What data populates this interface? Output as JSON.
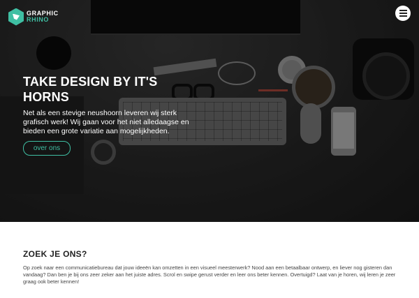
{
  "brand": {
    "name_line1": "GRAPHIC",
    "name_line2": "RHINO",
    "accent_color": "#3fbfa3"
  },
  "header": {
    "menu_icon": "hamburger-menu-icon"
  },
  "hero": {
    "title": "TAKE DESIGN BY IT'S HORNS",
    "text": "Net als een stevige neushoorn leveren wij sterk grafisch werk! Wij gaan voor het niet alledaagse en bieden een grote variatie aan mogelijkheden.",
    "button_label": "over ons"
  },
  "section": {
    "title": "ZOEK JE ONS?",
    "text": "Op zoek naar een communicatiebureau dat jouw ideeën kan omzetten in een visueel meesterwerk? Nood aan een betaalbaar ontwerp, en liever nog gisteren dan vandaag? Dan ben je bij ons zeer zeker aan het juiste adres. Scrol en swipe gerust verder en leer ons beter kennen. Overtuigd? Laat van je horen, wij leren je zeer graag ook beter kennen!"
  }
}
